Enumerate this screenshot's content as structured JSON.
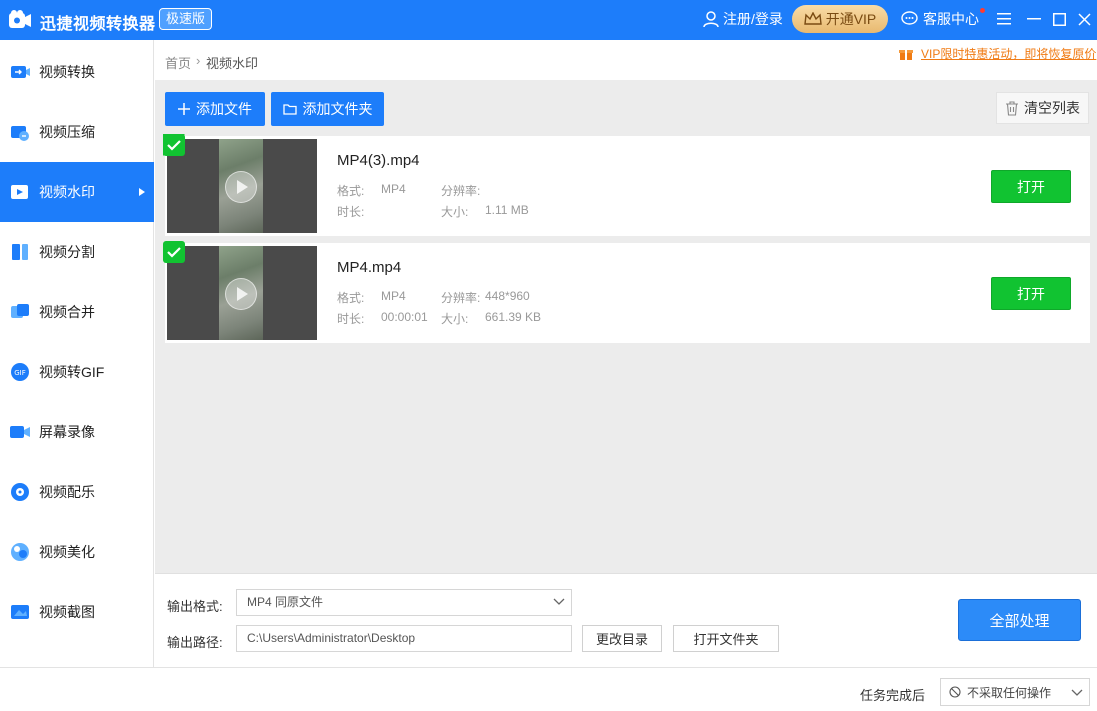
{
  "titlebar": {
    "app_title": "迅捷视频转换器",
    "edition": "极速版",
    "login": "注册/登录",
    "vip": "开通VIP",
    "service": "客服中心"
  },
  "sidebar": {
    "items": [
      {
        "label": "视频转换",
        "icon": "video-convert-icon"
      },
      {
        "label": "视频压缩",
        "icon": "video-compress-icon"
      },
      {
        "label": "视频水印",
        "icon": "video-watermark-icon",
        "active": true
      },
      {
        "label": "视频分割",
        "icon": "video-split-icon"
      },
      {
        "label": "视频合并",
        "icon": "video-merge-icon"
      },
      {
        "label": "视频转GIF",
        "icon": "gif-icon"
      },
      {
        "label": "屏幕录像",
        "icon": "screen-record-icon"
      },
      {
        "label": "视频配乐",
        "icon": "music-icon"
      },
      {
        "label": "视频美化",
        "icon": "beautify-icon"
      },
      {
        "label": "视频截图",
        "icon": "screenshot-icon"
      }
    ]
  },
  "breadcrumb": {
    "home": "首页",
    "separator": "›",
    "current": "视频水印"
  },
  "promo": "VIP限时特惠活动，即将恢复原价",
  "toolbar": {
    "add_file": "添加文件",
    "add_folder": "添加文件夹",
    "clear": "清空列表"
  },
  "files": [
    {
      "name": "MP4(3).mp4",
      "format_label": "格式:",
      "format": "MP4",
      "res_label": "分辨率:",
      "resolution": "",
      "duration_label": "时长:",
      "duration": "",
      "size_label": "大小:",
      "size": "1.11 MB",
      "open": "打开"
    },
    {
      "name": "MP4.mp4",
      "format_label": "格式:",
      "format": "MP4",
      "res_label": "分辨率:",
      "resolution": "448*960",
      "duration_label": "时长:",
      "duration": "00:00:01",
      "size_label": "大小:",
      "size": "661.39 KB",
      "open": "打开"
    }
  ],
  "output": {
    "format_label": "输出格式:",
    "format_value": "MP4  同原文件",
    "path_label": "输出路径:",
    "path_value": "C:\\Users\\Administrator\\Desktop",
    "change_dir": "更改目录",
    "open_folder": "打开文件夹",
    "process_all": "全部处理"
  },
  "status": {
    "after_label": "任务完成后",
    "after_value": "不采取任何操作"
  },
  "colors": {
    "brand": "#1d7dfa",
    "open_green": "#11c331",
    "promo_orange": "#f07b14",
    "vip_gold": "#e8b970"
  }
}
